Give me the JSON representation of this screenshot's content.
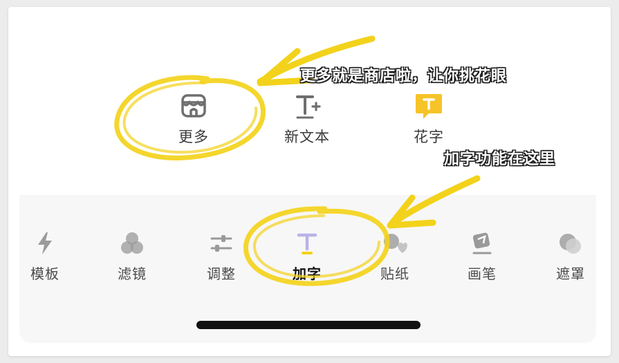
{
  "top_tools": [
    {
      "label": "更多",
      "icon": "store-icon"
    },
    {
      "label": "新文本",
      "icon": "text-add-icon"
    },
    {
      "label": "花字",
      "icon": "fancy-text-icon"
    }
  ],
  "bottom_tabs": [
    {
      "label": "模板",
      "icon": "lightning-icon"
    },
    {
      "label": "滤镜",
      "icon": "filter-circles-icon"
    },
    {
      "label": "调整",
      "icon": "sliders-icon"
    },
    {
      "label": "加字",
      "icon": "text-icon",
      "active": true
    },
    {
      "label": "贴纸",
      "icon": "sticker-icon"
    },
    {
      "label": "画笔",
      "icon": "brush-icon"
    },
    {
      "label": "遮罩",
      "icon": "mask-icon"
    }
  ],
  "annotations": {
    "more_hint": "更多就是商店啦，让你挑花眼",
    "add_text_hint": "加字功能在这里"
  },
  "colors": {
    "highlight_yellow": "#f3d21b",
    "active_purple": "#b9b3e8",
    "icon_gray": "#9a9a9a"
  }
}
